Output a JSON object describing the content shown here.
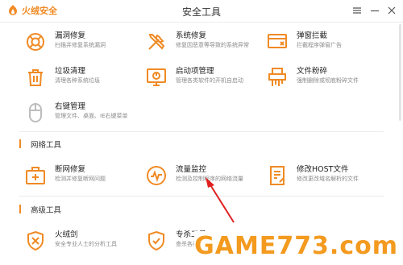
{
  "window": {
    "brand": "火绒安全",
    "title": "安全工具"
  },
  "colors": {
    "accent": "#f08a24",
    "watermark": "#f39a1f"
  },
  "tools_row1": [
    {
      "icon": "lifebuoy-icon",
      "title": "漏洞修复",
      "desc": "扫描并修复系统漏洞"
    },
    {
      "icon": "wrench-screwdriver-icon",
      "title": "系统修复",
      "desc": "修复因恶意等导致的系统异常"
    },
    {
      "icon": "popup-block-icon",
      "title": "弹窗拦截",
      "desc": "拦截程序弹窗广告"
    }
  ],
  "tools_row2": [
    {
      "icon": "trash-icon",
      "title": "垃圾清理",
      "desc": "清理各种系统垃圾"
    },
    {
      "icon": "monitor-startup-icon",
      "title": "启动项管理",
      "desc": "管理各类软件的开机自启动"
    },
    {
      "icon": "shredder-icon",
      "title": "文件粉碎",
      "desc": "强制删除或彻底粉碎文件"
    }
  ],
  "tools_row3": [
    {
      "icon": "mouse-icon",
      "title": "右键管理",
      "desc": "管理文件、桌面、IE右键菜单"
    }
  ],
  "network_section": {
    "label": "网络工具"
  },
  "tools_network": [
    {
      "icon": "first-aid-kit-icon",
      "title": "断网修复",
      "desc": "检测并修复断网问题"
    },
    {
      "icon": "traffic-gauge-icon",
      "title": "流量监控",
      "desc": "检测及控制程序的网络流量"
    },
    {
      "icon": "hosts-file-icon",
      "title": "修改HOST文件",
      "desc": "修改更改域名解析的文件"
    }
  ],
  "advanced_section": {
    "label": "高级工具"
  },
  "tools_advanced": [
    {
      "icon": "sword-shield-icon",
      "title": "火绒剑",
      "desc": "安全专业人士的分析工具"
    },
    {
      "icon": "shield-kill-icon",
      "title": "专杀工具",
      "desc": "查杀各类恶意性顽固病毒"
    }
  ],
  "watermark": "GAME773.com"
}
